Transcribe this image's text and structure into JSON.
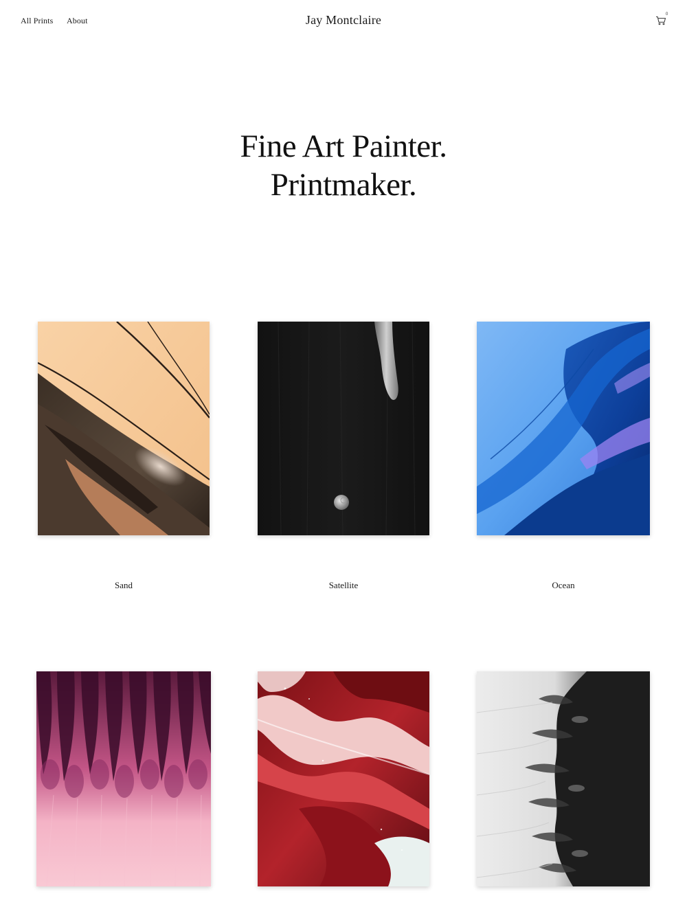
{
  "header": {
    "nav": [
      {
        "label": "All Prints"
      },
      {
        "label": "About"
      }
    ],
    "site_title": "Jay Montclaire",
    "cart": {
      "icon": "cart-icon",
      "count": "0"
    }
  },
  "hero": {
    "line1": "Fine Art Painter.",
    "line2": "Printmaker."
  },
  "products": [
    {
      "title": "Sand",
      "palette": "peach and brown"
    },
    {
      "title": "Satellite",
      "palette": "black and grey"
    },
    {
      "title": "Ocean",
      "palette": "blue"
    },
    {
      "title": "",
      "palette": "pink and purple"
    },
    {
      "title": "",
      "palette": "red and white"
    },
    {
      "title": "",
      "palette": "black and white"
    }
  ]
}
